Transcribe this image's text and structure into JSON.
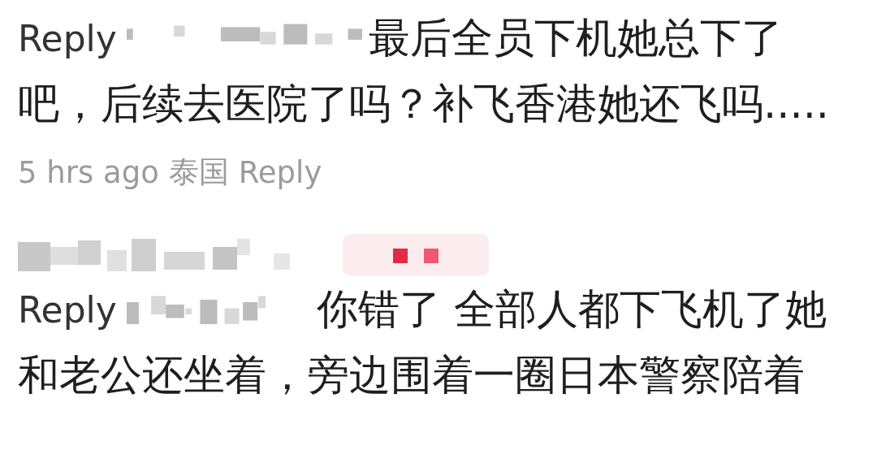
{
  "comments": [
    {
      "badge": false,
      "reply_prefix": "Reply",
      "lines": [
        "最后全员下机她总下了",
        "吧，后续去医院了吗？补飞香港她还飞吗....."
      ],
      "meta": {
        "time": "5 hrs ago",
        "location": "泰国",
        "reply": "Reply"
      }
    },
    {
      "badge": true,
      "reply_prefix": "Reply",
      "lines": [
        "你错了 全部人都下飞机了她",
        "和老公还坐着，旁边围着一圈日本警察陪着"
      ]
    }
  ]
}
